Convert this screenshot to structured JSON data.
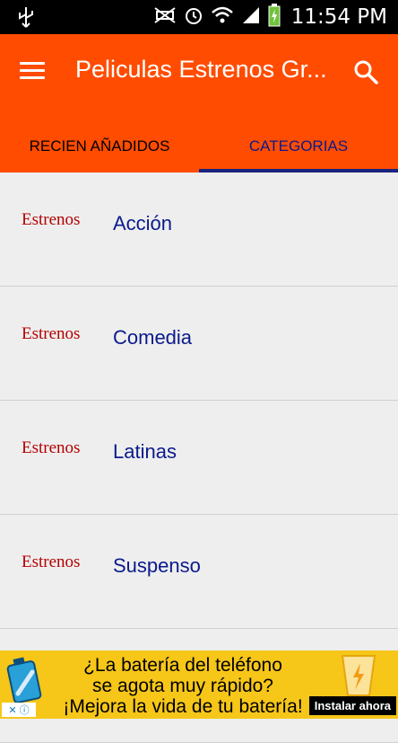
{
  "status_bar": {
    "time": "11:54 PM",
    "icons": [
      "usb-icon",
      "no-signal-icon",
      "alarm-icon",
      "wifi-icon",
      "signal-icon",
      "battery-charging-icon"
    ]
  },
  "app_bar": {
    "title": "Peliculas Estrenos Gr...",
    "menu_icon": "menu-icon",
    "search_icon": "search-icon",
    "color": "#ff4c00"
  },
  "tabs": [
    {
      "label": "RECIEN AÑADIDOS",
      "selected": false
    },
    {
      "label": "CATEGORIAS",
      "selected": true
    }
  ],
  "categories": [
    {
      "logo": "Estrenos",
      "label": "Acción"
    },
    {
      "logo": "Estrenos",
      "label": "Comedia"
    },
    {
      "logo": "Estrenos",
      "label": "Latinas"
    },
    {
      "logo": "Estrenos",
      "label": "Suspenso"
    },
    {
      "logo": "",
      "label": ""
    }
  ],
  "ad": {
    "line1": "¿La batería del teléfono",
    "line2": "se agota muy rápido?",
    "line3": "¡Mejora la vida de tu batería!",
    "button": "Instalar ahora",
    "close_icon": "close-icon",
    "info_icon": "info-icon"
  }
}
